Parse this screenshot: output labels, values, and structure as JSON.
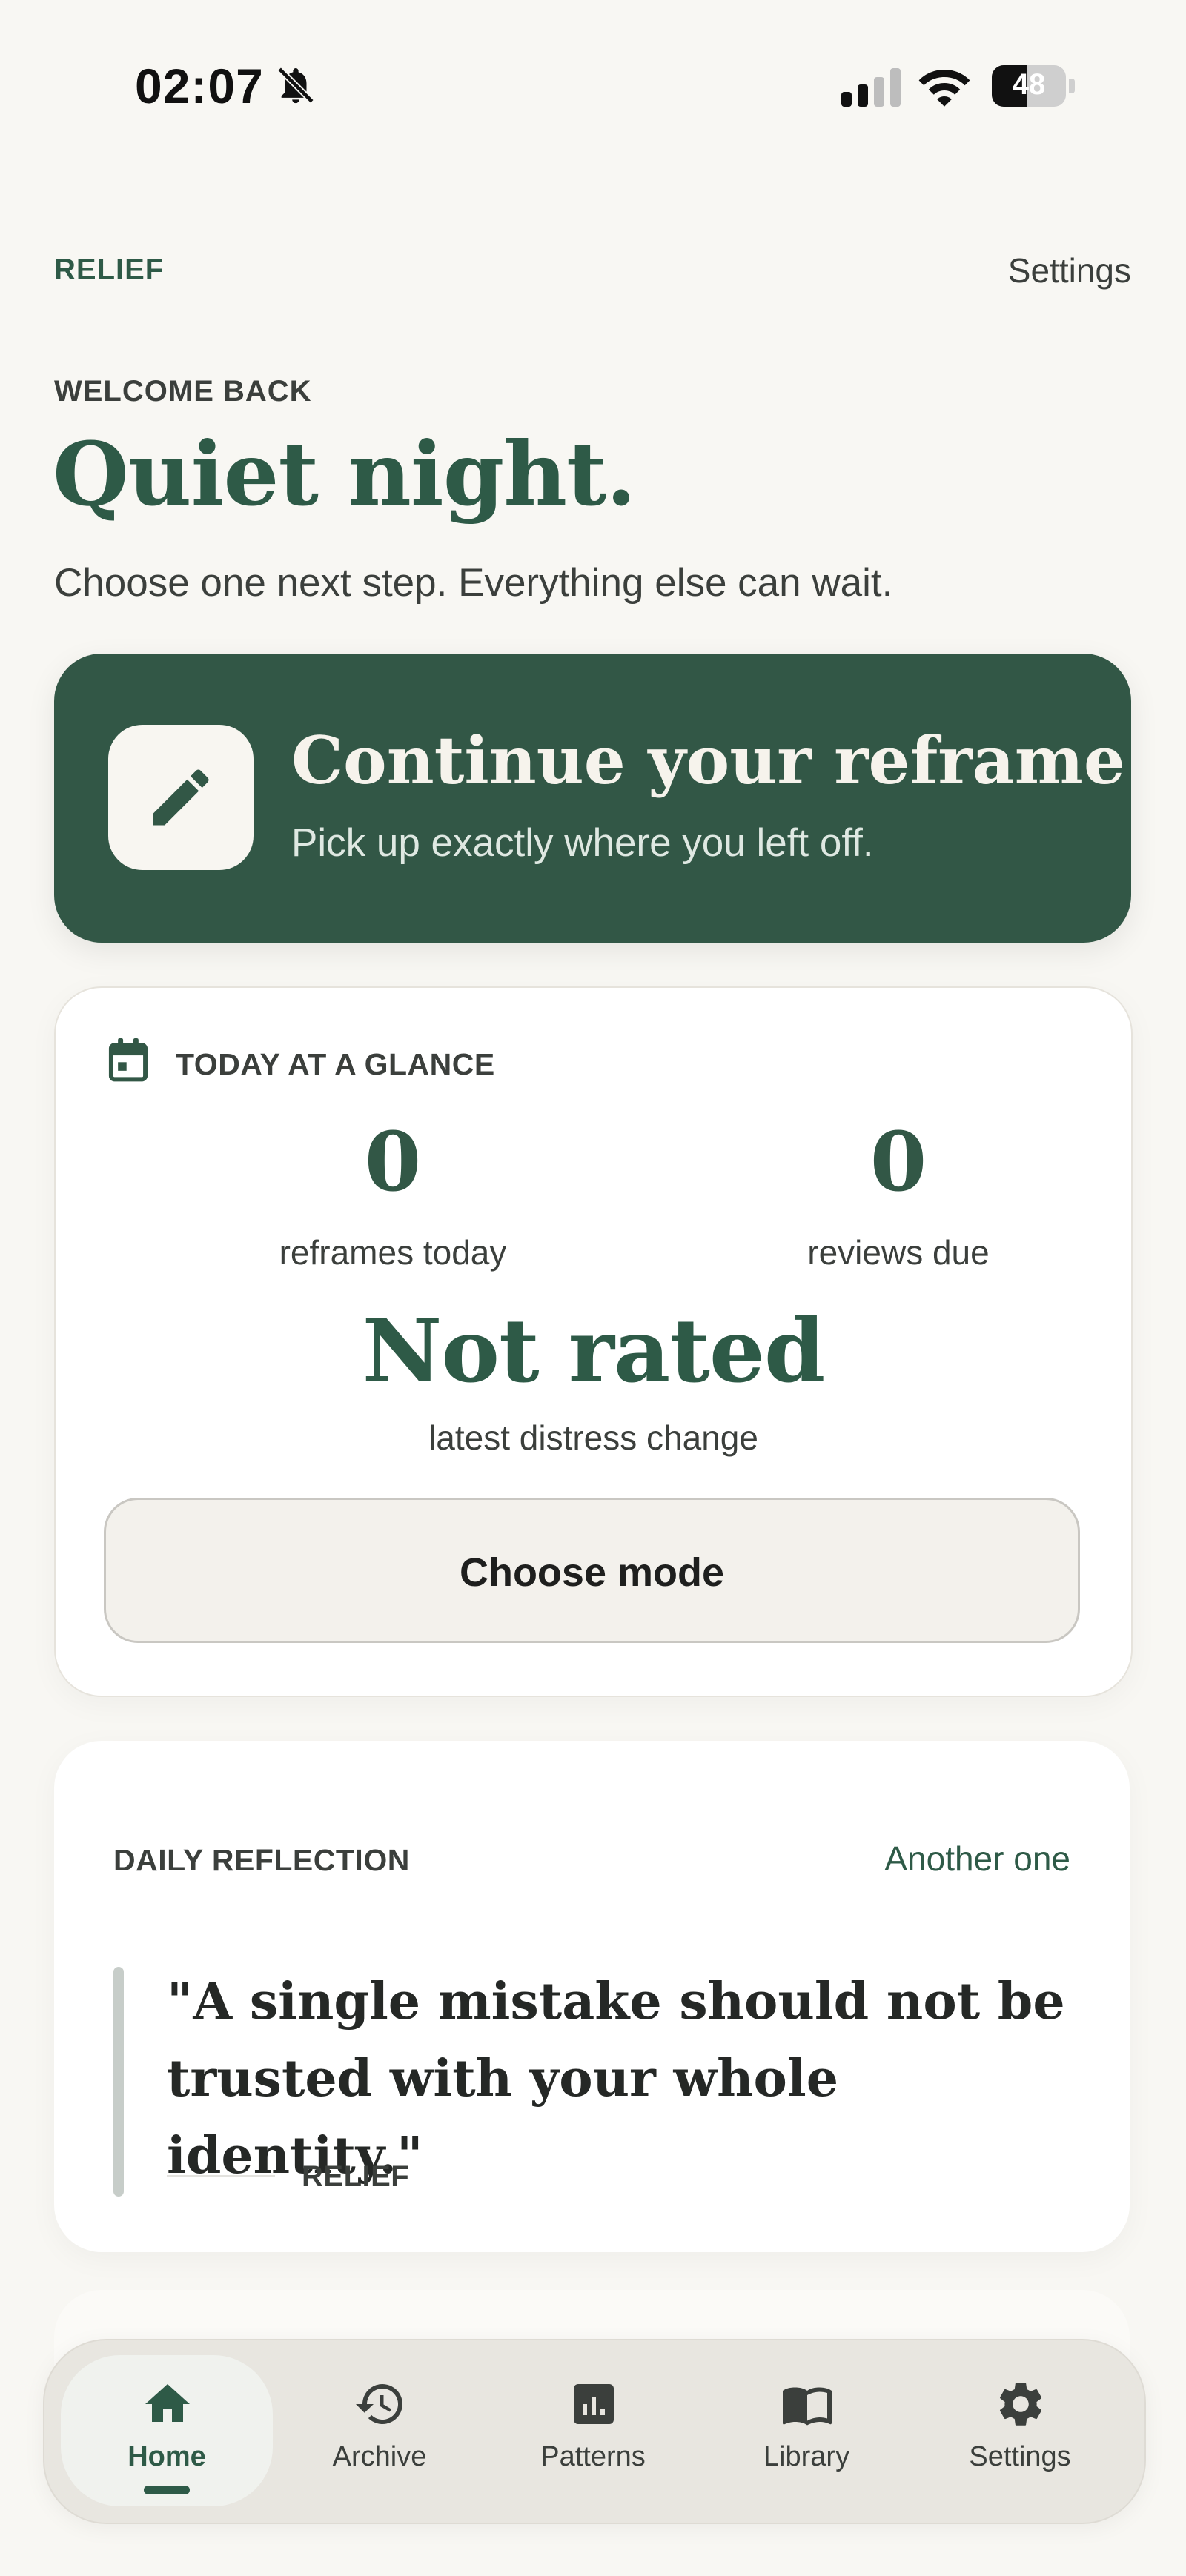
{
  "status_bar": {
    "time": "02:07",
    "battery": "48",
    "battery_level": 0.48
  },
  "header": {
    "brand": "RELIEF",
    "settings_label": "Settings"
  },
  "hero": {
    "eyebrow": "WELCOME BACK",
    "title": "Quiet night.",
    "subtitle": "Choose one next step. Everything else can wait."
  },
  "cta": {
    "title": "Continue your reframe",
    "subtitle": "Pick up exactly where you left off.",
    "icon": "pencil-icon"
  },
  "today": {
    "label": "TODAY AT A GLANCE",
    "icon": "calendar-icon",
    "reframes_count": "0",
    "reframes_label": "reframes today",
    "reviews_count": "0",
    "reviews_label": "reviews due",
    "distress_value": "Not rated",
    "distress_label": "latest distress change",
    "choose_mode_label": "Choose mode"
  },
  "reflection": {
    "label": "DAILY REFLECTION",
    "another_label": "Another one",
    "quote": "\"A single mistake should not be trusted with your whole identity.\"",
    "source": "RELIEF"
  },
  "tabbar": {
    "tabs": [
      {
        "label": "Home",
        "icon": "home-icon",
        "active": true
      },
      {
        "label": "Archive",
        "icon": "history-icon",
        "active": false
      },
      {
        "label": "Patterns",
        "icon": "chart-icon",
        "active": false
      },
      {
        "label": "Library",
        "icon": "book-icon",
        "active": false
      },
      {
        "label": "Settings",
        "icon": "gear-icon",
        "active": false
      }
    ]
  },
  "colors": {
    "accent": "#2e5a47",
    "cta_background": "#325746",
    "background": "#f8f7f3",
    "card": "#ffffff"
  }
}
